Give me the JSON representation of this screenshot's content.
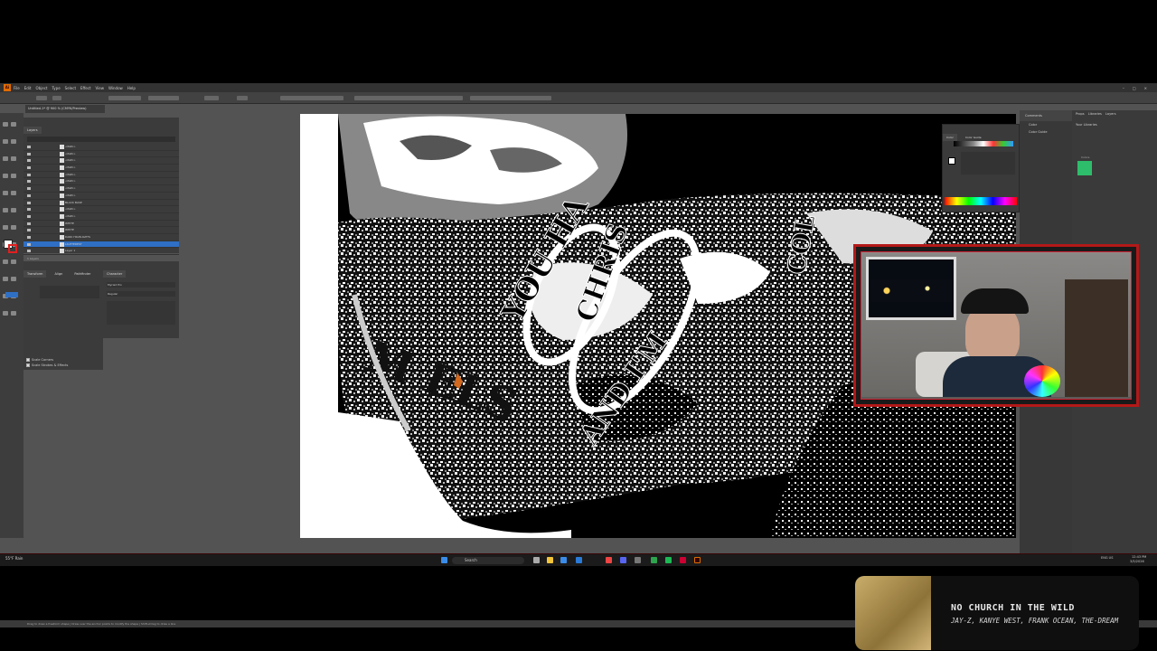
{
  "menu": [
    "File",
    "Edit",
    "Object",
    "Type",
    "Select",
    "Effect",
    "View",
    "Window",
    "Help"
  ],
  "document_tab": "Untitled-1* @ 900 % (CMYK/Preview)",
  "layers_panel": {
    "tabs": [
      "Layers"
    ],
    "rows": [
      "<Path>",
      "<Path>",
      "<Path>",
      "<Path>",
      "<Path>",
      "<Path>",
      "<Path>",
      "<Path>",
      "BLACK BASE",
      "<Path>",
      "<Path>",
      "WHITE",
      "WHITE",
      "DARK HIGHLIGHTS",
      "LIGHTEREST",
      "Layer 1"
    ],
    "footer": "1 Layers"
  },
  "transform_panel": {
    "tabs": [
      "Transform",
      "Align",
      "Pathfinder"
    ],
    "options": [
      "Scale Corners",
      "Scale Strokes & Effects"
    ]
  },
  "character_panel": {
    "tabs": [
      "Character"
    ],
    "font": "Myriad Pro",
    "style": "Regular"
  },
  "color_panel": {
    "tabs": [
      "Color",
      "Color Guide"
    ]
  },
  "right_panel": {
    "tabs": [
      "Comments"
    ],
    "items": [
      "Color",
      "Color Guide"
    ]
  },
  "libraries_panel": {
    "tabs": [
      "Props",
      "Libraries",
      "Layers"
    ],
    "heading": "Your Libraries",
    "section": "Colors",
    "swatch_color": "#2ebd6b"
  },
  "statusbar": {
    "hint": "Drag to draw a freeform shape | Draw over the anchor points to modify the shape | Shift+Drag to draw a line"
  },
  "taskbar": {
    "weather": "55°F Rain",
    "search": "Search",
    "lang": "ENG US",
    "time": "12:43 PM",
    "date": "3/5/2026"
  },
  "now_playing": {
    "song": "NO CHURCH IN THE WILD",
    "artist": "JAY-Z, KANYE WEST, FRANK OCEAN, THE-DREAM"
  },
  "colors": {
    "accent": "#b31818",
    "selection": "#2f6fc4"
  }
}
